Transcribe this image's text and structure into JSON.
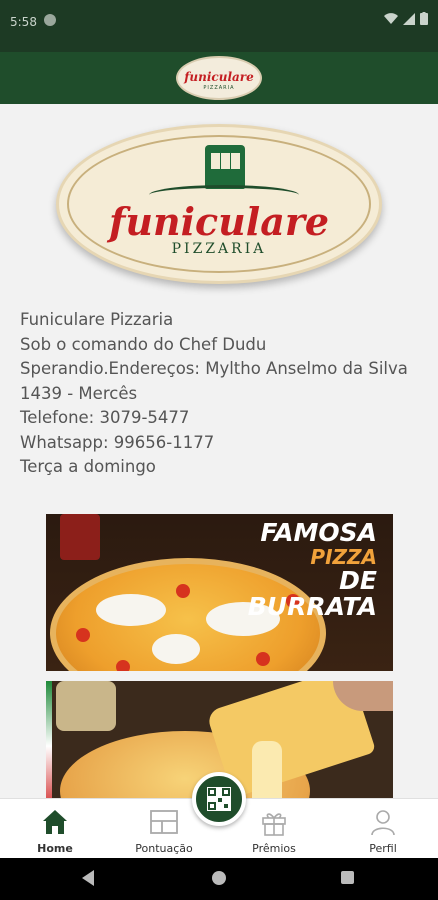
{
  "status_bar": {
    "time": "5:58"
  },
  "app_bar": {
    "logo_text": "funiculare",
    "logo_sub": "PIZZARIA"
  },
  "brand": {
    "name": "funiculare",
    "sub": "PIZZARIA"
  },
  "info": {
    "lines": [
      "Funiculare Pizzaria",
      "Sob o comando do Chef Dudu",
      "Sperandio.Endereços: Myltho Anselmo da Silva",
      "1439 - Mercês",
      "Telefone: 3079-5477",
      "Whatsapp: 99656-1177",
      "Terça a domingo"
    ]
  },
  "promo": {
    "line1": "FAMOSA",
    "line2": "PIZZA",
    "line3": "DE BURRATA"
  },
  "bottom_nav": {
    "items": [
      {
        "label": "Home",
        "icon": "home-icon",
        "active": true
      },
      {
        "label": "Pontuação",
        "icon": "scoreboard-icon",
        "active": false
      },
      {
        "label": "Prêmios",
        "icon": "gift-icon",
        "active": false
      },
      {
        "label": "Perfil",
        "icon": "person-icon",
        "active": false
      }
    ]
  },
  "colors": {
    "primary": "#1f4d2b",
    "brand_red": "#c41e22",
    "text": "#555555"
  }
}
